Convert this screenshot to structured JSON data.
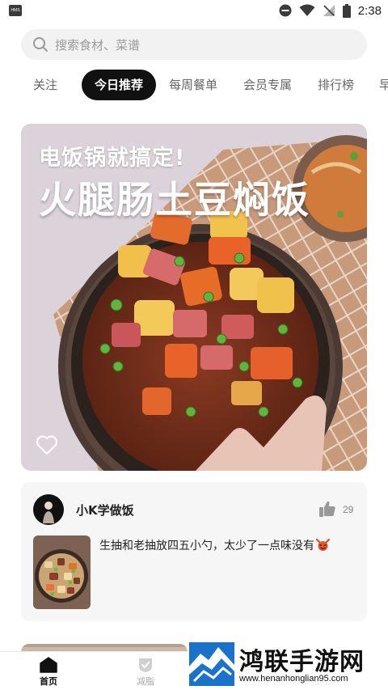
{
  "status_bar": {
    "app_badge": "HMS",
    "time": "2:38"
  },
  "search": {
    "placeholder": "搜索食材、菜谱"
  },
  "tabs": [
    {
      "label": "关注",
      "active": false
    },
    {
      "label": "今日推荐",
      "active": true
    },
    {
      "label": "每周餐单",
      "active": false
    },
    {
      "label": "会员专属",
      "active": false
    },
    {
      "label": "排行榜",
      "active": false
    },
    {
      "label": "早",
      "active": false
    }
  ],
  "hero": {
    "subtitle": "电饭锅就搞定!",
    "title": "火腿肠土豆焖饭",
    "liked": false
  },
  "comment": {
    "username": "小K学做饭",
    "like_count": "29",
    "text": "生抽和老抽放四五小勺，太少了一点味没有",
    "emoji": "devil-emoji"
  },
  "bottom_nav": {
    "items": [
      {
        "label": "首页",
        "icon": "home-icon",
        "active": true
      },
      {
        "label": "减脂",
        "icon": "shield-check-icon",
        "active": false
      }
    ]
  },
  "watermark": {
    "text": "鸿联手游网",
    "url": "www.henanhonglian95.com"
  },
  "colors": {
    "accent": "#111111",
    "search_bg": "#f2f2f2",
    "card_bg": "#f6f6f6",
    "watermark_blue": "#1a73c8"
  }
}
